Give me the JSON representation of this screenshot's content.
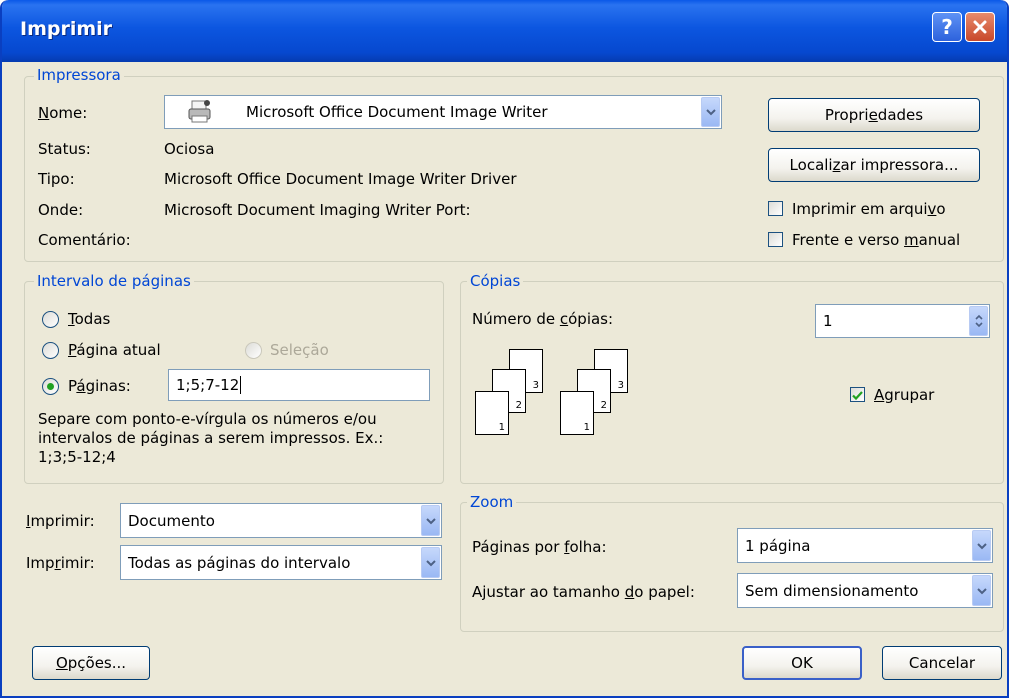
{
  "window": {
    "title": "Imprimir"
  },
  "printer": {
    "legend": "Impressora",
    "name_label": "Nome:",
    "name_value": "Microsoft Office Document Image Writer",
    "status_label": "Status:",
    "status_value": "Ociosa",
    "type_label": "Tipo:",
    "type_value": "Microsoft Office Document Image Writer Driver",
    "where_label": "Onde:",
    "where_value": "Microsoft Document Imaging Writer Port:",
    "comment_label": "Comentário:",
    "properties_button": "Propriedades",
    "find_printer_button": "Localizar impressora...",
    "print_to_file": {
      "label": "Imprimir em arquivo",
      "checked": false
    },
    "manual_duplex": {
      "label": "Frente e verso manual",
      "checked": false
    }
  },
  "page_range": {
    "legend": "Intervalo de páginas",
    "all_label": "Todas",
    "current_label": "Página atual",
    "selection_label": "Seleção",
    "pages_label": "Páginas:",
    "pages_value": "1;5;7-12",
    "selected": "pages",
    "help_line1": "Separe com ponto-e-vírgula os números e/ou",
    "help_line2": "intervalos de páginas a serem impressos.  Ex.:",
    "help_line3": "1;3;5-12;4"
  },
  "copies": {
    "legend": "Cópias",
    "count_label": "Número de cópias:",
    "count_value": "1",
    "collate_label": "Agrupar",
    "collate_checked": true,
    "page_numbers": [
      "1",
      "2",
      "3"
    ]
  },
  "print_what": {
    "label1": "Imprimir:",
    "value1": "Documento",
    "label2": "Imprimir:",
    "value2": "Todas as páginas do intervalo"
  },
  "zoom": {
    "legend": "Zoom",
    "pages_per_sheet_label": "Páginas por folha:",
    "pages_per_sheet_value": "1 página",
    "scale_label": "Ajustar ao tamanho do papel:",
    "scale_value": "Sem dimensionamento"
  },
  "footer": {
    "options_button": "Opções...",
    "ok_button": "OK",
    "cancel_button": "Cancelar"
  },
  "colors": {
    "accent": "#0046d5",
    "titlebar": "#0a58e8"
  }
}
